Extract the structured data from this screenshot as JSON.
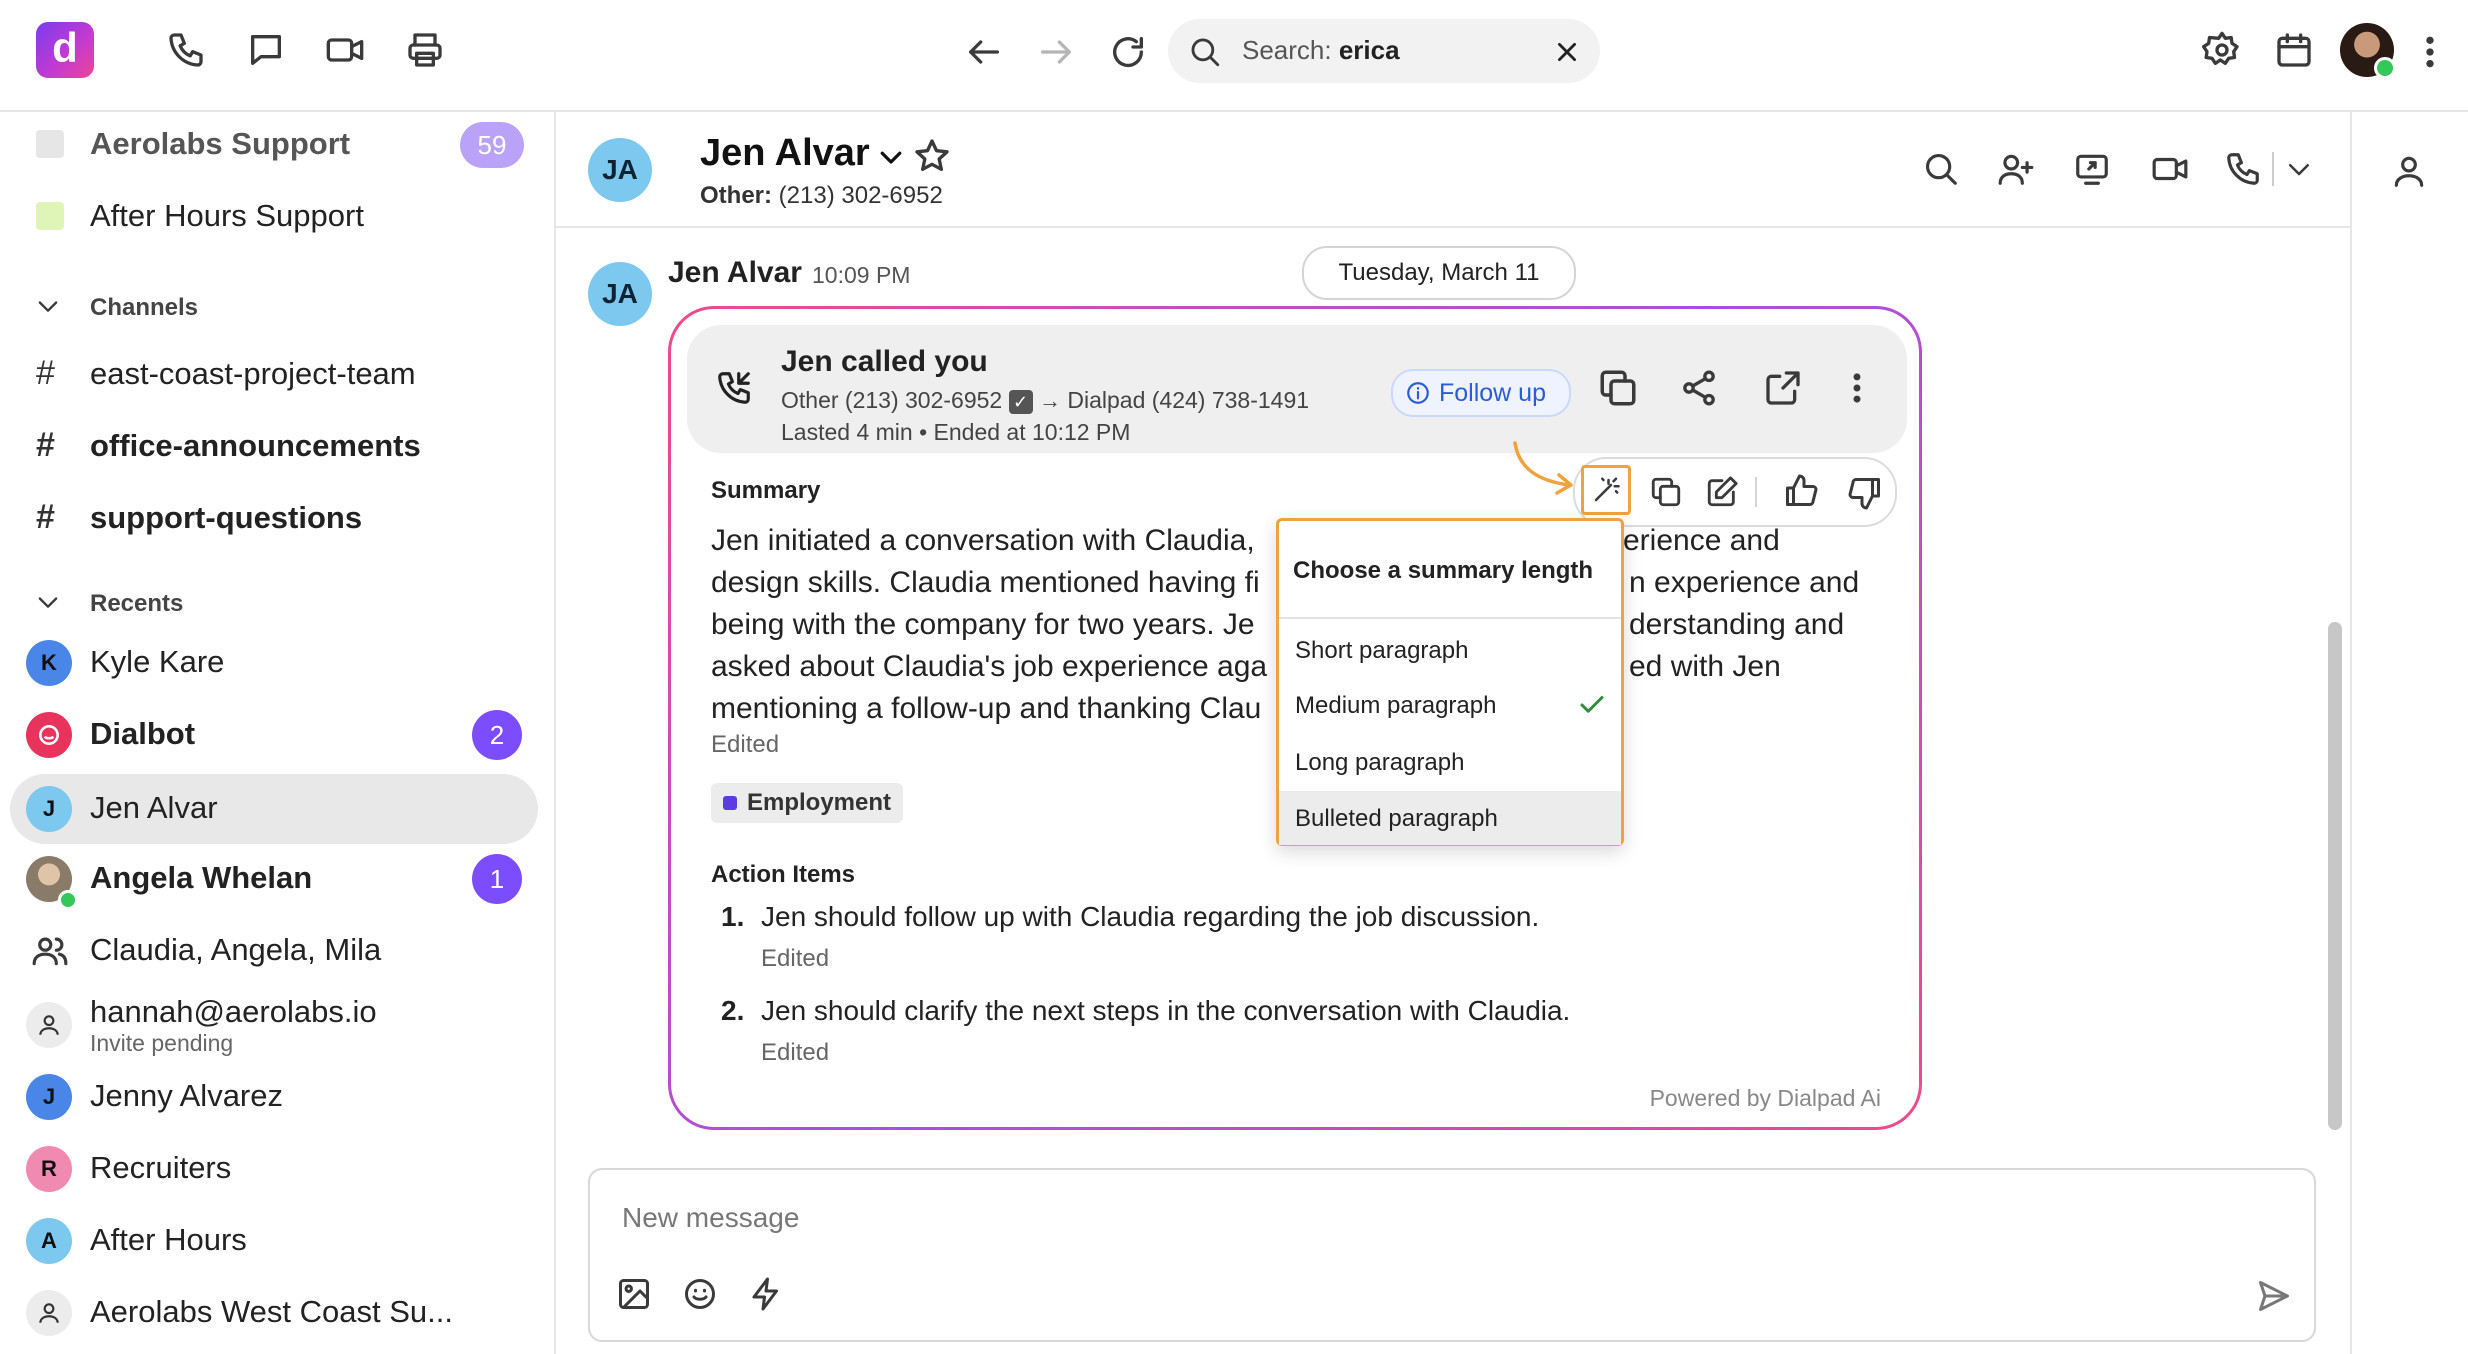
{
  "app": {
    "logo_letter": "d",
    "brand_gradient": [
      "#7a3cf0",
      "#f0439a"
    ]
  },
  "topbar": {
    "search": {
      "label": "Search:",
      "value": "erica"
    }
  },
  "sidebar": {
    "inboxes": [
      {
        "label": "Aerolabs Support",
        "badge": "59",
        "color": "#e6e6e6"
      },
      {
        "label": "After Hours Support",
        "color": "#dff5b8"
      }
    ],
    "channels_header": "Channels",
    "channels": [
      {
        "label": "east-coast-project-team",
        "bold": false
      },
      {
        "label": "office-announcements",
        "bold": true
      },
      {
        "label": "support-questions",
        "bold": true
      }
    ],
    "recents_header": "Recents",
    "recents": [
      {
        "label": "Kyle Kare",
        "initial": "K",
        "color": "#4a86e8"
      },
      {
        "label": "Dialbot",
        "badge": "2",
        "color": "#e8345c"
      },
      {
        "label": "Jen Alvar",
        "initial": "J",
        "color": "#7cc8ef",
        "selected": true
      },
      {
        "label": "Angela Whelan",
        "badge": "1"
      },
      {
        "label": "Claudia, Angela, Mila"
      },
      {
        "label": "hannah@aerolabs.io",
        "sub": "Invite pending"
      },
      {
        "label": "Jenny Alvarez",
        "initial": "J",
        "color": "#4a86e8"
      },
      {
        "label": "Recruiters",
        "initial": "R",
        "color": "#f08ab0"
      },
      {
        "label": "After Hours",
        "initial": "A",
        "color": "#7cc8ef"
      },
      {
        "label": "Aerolabs West Coast Su..."
      }
    ]
  },
  "header": {
    "initials": "JA",
    "name": "Jen Alvar",
    "phone_label": "Other:",
    "phone": "(213) 302-6952"
  },
  "message": {
    "initials": "JA",
    "sender": "Jen Alvar",
    "time": "10:09 PM",
    "date_divider": "Tuesday, March 11",
    "call": {
      "title": "Jen called you",
      "from": "Other (213) 302-6952",
      "to": "Dialpad (424) 738-1491",
      "meta": "Lasted 4 min • Ended at 10:12 PM",
      "follow_up": "Follow up"
    },
    "summary_heading": "Summary",
    "summary_lines": [
      {
        "left": "Jen initiated a conversation with Claudia,",
        "right": "erience and"
      },
      {
        "left": "design skills. Claudia mentioned having fi",
        "right": "n experience and"
      },
      {
        "left": "being with the company for two years. Je",
        "right": "derstanding and"
      },
      {
        "left": "asked about Claudia's job experience aga",
        "right": "ed with Jen"
      },
      {
        "left": "mentioning a follow-up and thanking Clau",
        "right": ""
      }
    ],
    "edited": "Edited",
    "tag": "Employment",
    "action_items_heading": "Action Items",
    "action_items": [
      {
        "num": "1.",
        "text": "Jen should follow up with Claudia regarding the job discussion.",
        "edited": "Edited"
      },
      {
        "num": "2.",
        "text": "Jen should clarify the next steps in the conversation with Claudia.",
        "edited": "Edited"
      }
    ],
    "powered_by": "Powered by Dialpad Ai"
  },
  "dropdown": {
    "title": "Choose a summary length",
    "options": [
      {
        "label": "Short paragraph"
      },
      {
        "label": "Medium paragraph",
        "checked": true
      },
      {
        "label": "Long paragraph"
      },
      {
        "label": "Bulleted paragraph",
        "hover": true
      }
    ],
    "highlight_color": "#f0a23d"
  },
  "composer": {
    "placeholder": "New message"
  }
}
